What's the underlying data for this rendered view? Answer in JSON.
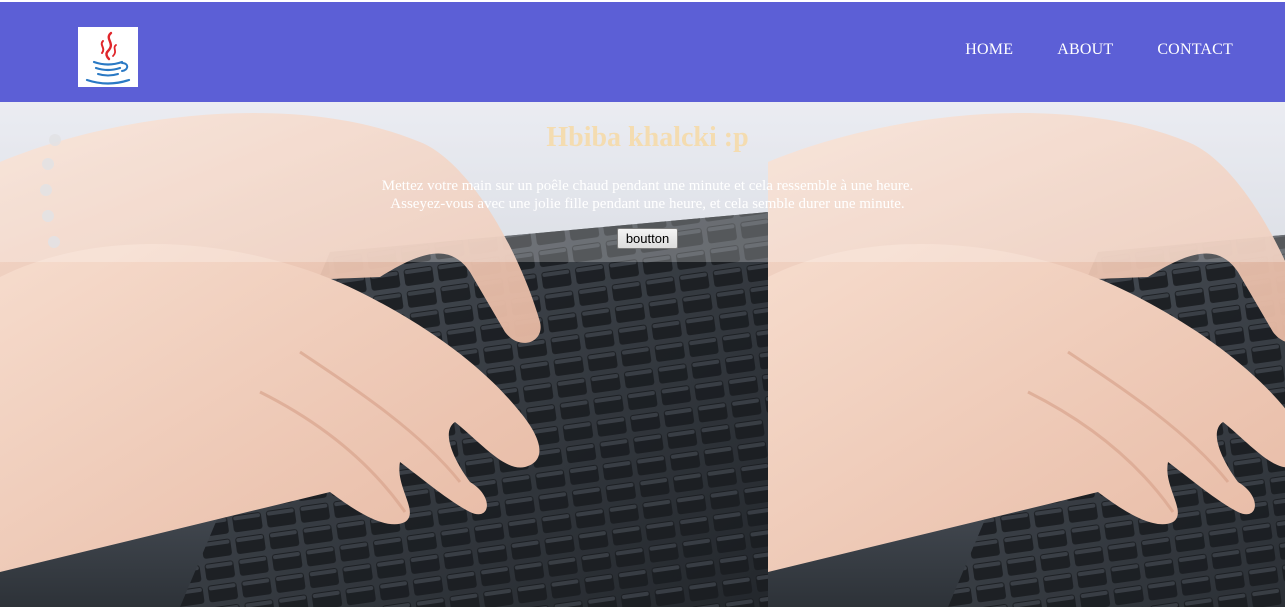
{
  "header": {
    "logo_icon": "java-cup-icon",
    "nav": [
      {
        "label": "HOME"
      },
      {
        "label": "ABOUT"
      },
      {
        "label": "CONTACT"
      }
    ],
    "background_color": "#5c5fd6"
  },
  "hero": {
    "title": "Hbiba khalcki :p",
    "text_line_1": "Mettez votre main sur un poêle chaud pendant une minute et cela ressemble à une heure.",
    "text_line_2": "Asseyez-vous avec une jolie fille pendant une heure, et cela semble durer une minute.",
    "button_label": "boutton",
    "title_color": "#f4dcb0",
    "background_image": "hands-typing-on-laptop-keyboard"
  }
}
